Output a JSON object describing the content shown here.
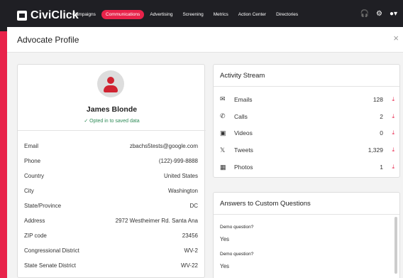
{
  "app": {
    "logo": "CiviClick",
    "nav": [
      "Campaigns",
      "Communications",
      "Advertising",
      "Screening",
      "Metrics",
      "Action Center",
      "Directories"
    ],
    "active_nav": "Communications"
  },
  "modal": {
    "title": "Advocate Profile",
    "close": "×"
  },
  "profile": {
    "name": "James Blonde",
    "opt_in": "✓  Opted in to saved data",
    "fields": [
      {
        "label": "Email",
        "value": "zbachs5tests@google.com"
      },
      {
        "label": "Phone",
        "value": "(122)-999-8888"
      },
      {
        "label": "Country",
        "value": "United States"
      },
      {
        "label": "City",
        "value": "Washington"
      },
      {
        "label": "State/Province",
        "value": "DC"
      },
      {
        "label": "Address",
        "value": "2972 Westheimer Rd. Santa Ana"
      },
      {
        "label": "ZIP code",
        "value": "23456"
      },
      {
        "label": "Congressional District",
        "value": "WV-2"
      },
      {
        "label": "State Senate District",
        "value": "WV-22"
      }
    ]
  },
  "activity": {
    "title": "Activity Stream",
    "items": [
      {
        "label": "Emails",
        "count": "128",
        "icon": "envelope-icon"
      },
      {
        "label": "Calls",
        "count": "2",
        "icon": "phone-icon"
      },
      {
        "label": "Videos",
        "count": "0",
        "icon": "video-icon"
      },
      {
        "label": "Tweets",
        "count": "1,329",
        "icon": "x-icon"
      },
      {
        "label": "Photos",
        "count": "1",
        "icon": "photo-icon"
      }
    ]
  },
  "questions": {
    "title": "Answers to Custom Questions",
    "items": [
      {
        "question": "Demo question?",
        "answer": "Yes"
      },
      {
        "question": "Demo question?",
        "answer": "Yes"
      }
    ]
  }
}
